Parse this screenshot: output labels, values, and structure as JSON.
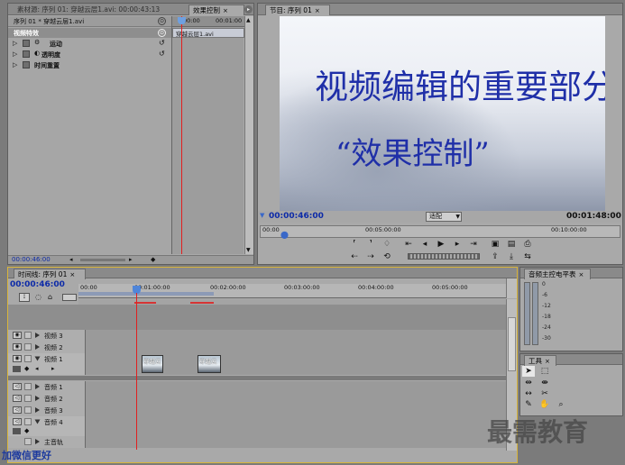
{
  "source_monitor": {
    "tabs": [
      {
        "label": "素材源: 序列 01: 穿越云层1.avi: 00:00:43:13"
      },
      {
        "label": "效果控制"
      }
    ],
    "sequence_label": "序列 01 * 穿越云层1.avi",
    "mini_timecode_start": "00:00",
    "mini_timecode_end": "00:01:00",
    "clip_label": "穿越云层1.avi",
    "section_header": "视频特效",
    "effects": [
      {
        "label": "运动"
      },
      {
        "label": "透明度"
      },
      {
        "label": "时间重置"
      }
    ],
    "footer_timecode": "00:00:46:00"
  },
  "program_monitor": {
    "tab_label": "节目: 序列 01",
    "video_title": "视频编辑的重要部分",
    "video_subtitle": "“效果控制”",
    "current_timecode": "00:00:46:00",
    "fit_label": "适配",
    "duration_timecode": "00:01:48:00",
    "ruler_start": "00:00",
    "ruler_mid1": "00:05:00:00",
    "ruler_mid2": "00:10:00:00",
    "transport_icons": [
      "mark-in-icon",
      "mark-out-icon",
      "marker-icon",
      "go-in-icon",
      "step-back-icon",
      "play-icon",
      "step-forward-icon",
      "go-out-icon",
      "loop-icon",
      "safe-margins-icon",
      "export-frame-icon"
    ]
  },
  "timeline": {
    "tab_label": "时间线: 序列 01",
    "current_timecode": "00:00:46:00",
    "ruler_labels": [
      "00:00",
      "00:01:00:00",
      "00:02:00:00",
      "00:03:00:00",
      "00:04:00:00",
      "00:05:00:00"
    ],
    "tracks": [
      {
        "label": "视频 3"
      },
      {
        "label": "视频 2"
      },
      {
        "label": "视频 1"
      },
      {
        "label": "音频 1"
      },
      {
        "label": "音频 2"
      },
      {
        "label": "音频 3"
      },
      {
        "label": "音频 4"
      },
      {
        "label": "主音轨"
      }
    ],
    "clips": [
      {
        "label": "穿越云"
      },
      {
        "label": "穿越云"
      }
    ]
  },
  "audio_mixer": {
    "tab_label": "音频主控电平表",
    "meter_labels": [
      "0",
      "-6",
      "-12",
      "-18",
      "-24",
      "-30"
    ]
  },
  "tools": {
    "tab_label": "工具"
  },
  "watermark": {
    "right_text": "最需教育",
    "left_text": "加微信更好"
  }
}
